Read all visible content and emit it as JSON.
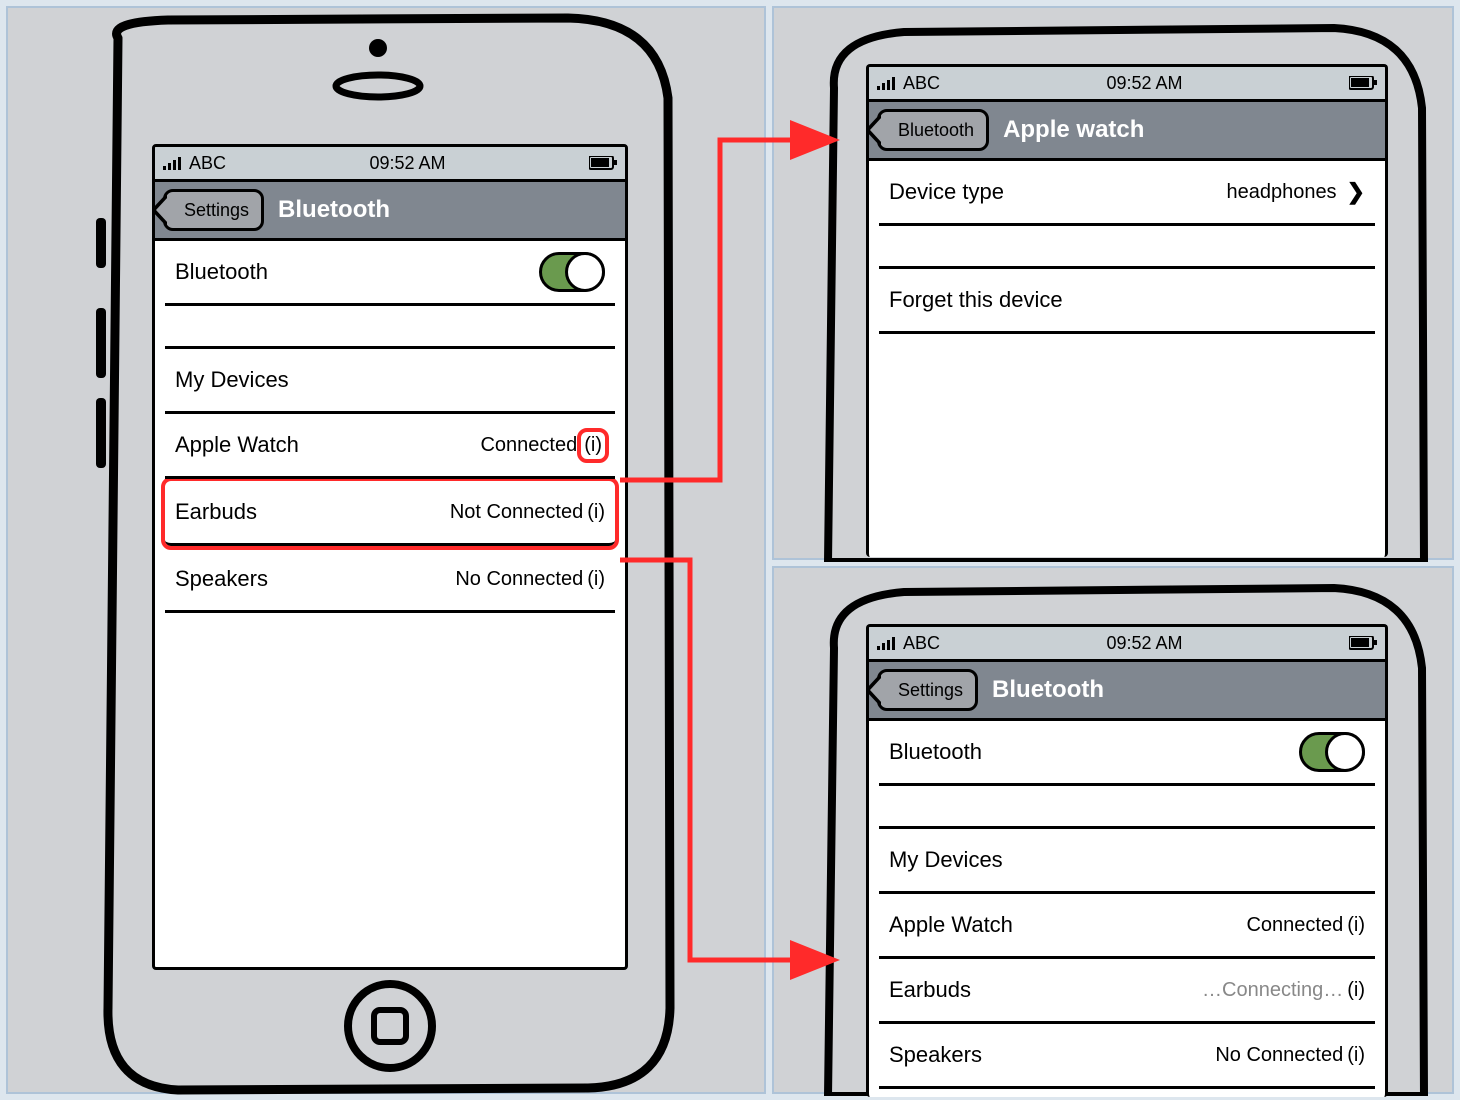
{
  "statusbar": {
    "carrier": "ABC",
    "time": "09:52 AM"
  },
  "screen1": {
    "back": "Settings",
    "title": "Bluetooth",
    "toggle_label": "Bluetooth",
    "section": "My Devices",
    "devices": [
      {
        "name": "Apple Watch",
        "status": "Connected",
        "info": "(i)"
      },
      {
        "name": "Earbuds",
        "status": "Not Connected",
        "info": "(i)"
      },
      {
        "name": "Speakers",
        "status": "No Connected",
        "info": "(i)"
      }
    ]
  },
  "screen2": {
    "back": "Bluetooth",
    "title": "Apple watch",
    "rows": {
      "device_type_label": "Device type",
      "device_type_value": "headphones",
      "forget": "Forget this device"
    }
  },
  "screen3": {
    "back": "Settings",
    "title": "Bluetooth",
    "toggle_label": "Bluetooth",
    "section": "My Devices",
    "devices": [
      {
        "name": "Apple Watch",
        "status": "Connected",
        "info": "(i)"
      },
      {
        "name": "Earbuds",
        "status": "…Connecting…",
        "info": "(i)",
        "gray": true
      },
      {
        "name": "Speakers",
        "status": "No Connected",
        "info": "(i)"
      }
    ]
  }
}
